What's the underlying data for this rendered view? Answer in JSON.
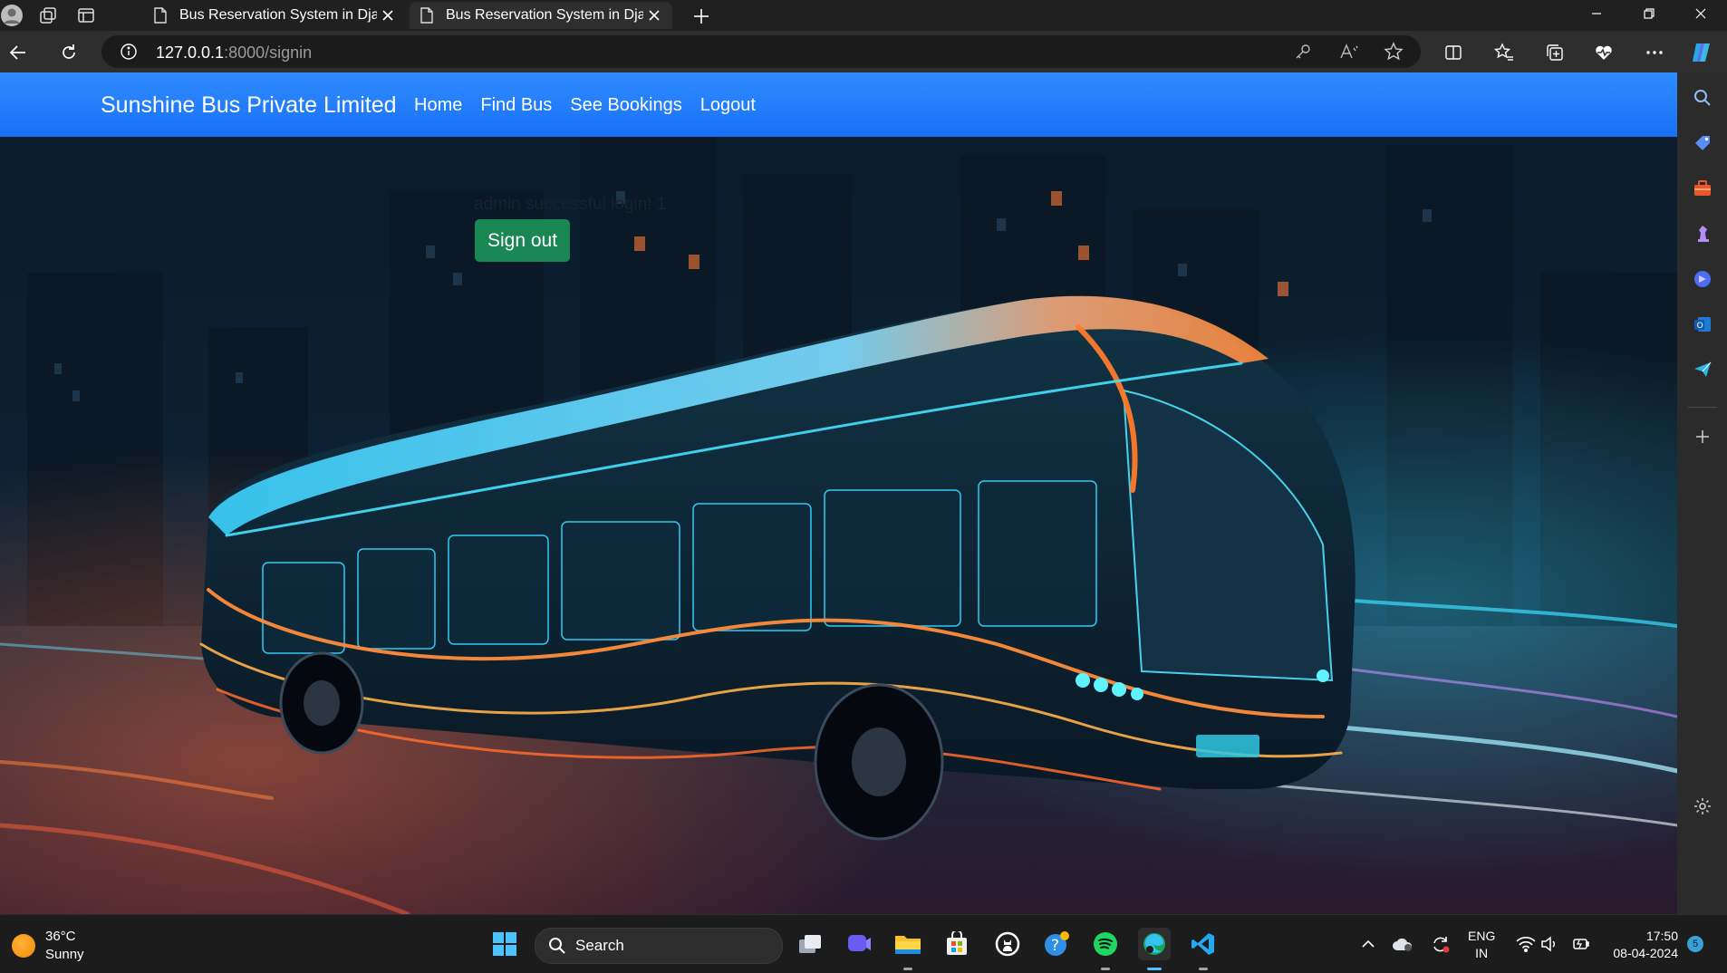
{
  "browser": {
    "tabs": [
      {
        "title": "Bus Reservation System in Djang",
        "active": false
      },
      {
        "title": "Bus Reservation System in Djang",
        "active": true
      }
    ],
    "address": {
      "host": "127.0.0.1",
      "path": ":8000/signin"
    }
  },
  "site": {
    "brand": "Sunshine Bus Private Limited",
    "nav": {
      "home": "Home",
      "find_bus": "Find Bus",
      "see_bookings": "See Bookings",
      "logout": "Logout"
    },
    "message": "admin successful login! 1",
    "signout_label": "Sign out"
  },
  "taskbar": {
    "weather": {
      "temp": "36°C",
      "condition": "Sunny"
    },
    "search_label": "Search",
    "lang_line1": "ENG",
    "lang_line2": "IN",
    "time": "17:50",
    "date": "08-04-2024",
    "notification_count": "5"
  },
  "colors": {
    "navbar": "#1c74f7",
    "signout": "#198754",
    "chrome": "#202020"
  }
}
